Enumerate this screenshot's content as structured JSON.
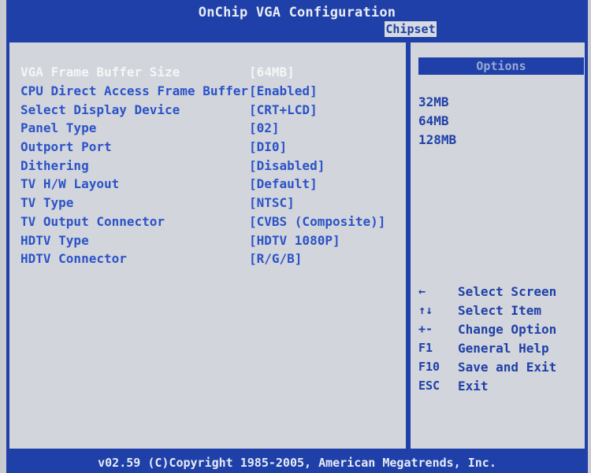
{
  "header": {
    "title": "OnChip VGA Configuration",
    "tab_label": "Chipset"
  },
  "settings": [
    {
      "label": "VGA Frame Buffer Size",
      "value": "[64MB]"
    },
    {
      "label": "CPU Direct Access Frame Buffer",
      "value": "[Enabled]"
    },
    {
      "label": "Select Display Device",
      "value": "[CRT+LCD]"
    },
    {
      "label": "Panel Type",
      "value": "[02]"
    },
    {
      "label": "Outport Port",
      "value": "[DI0]"
    },
    {
      "label": "Dithering",
      "value": "[Disabled]"
    },
    {
      "label": "TV H/W Layout",
      "value": "[Default]"
    },
    {
      "label": "TV Type",
      "value": "[NTSC]"
    },
    {
      "label": "TV Output Connector",
      "value": "[CVBS (Composite)]"
    },
    {
      "label": "HDTV Type",
      "value": "[HDTV 1080P]"
    },
    {
      "label": "HDTV Connector",
      "value": "[R/G/B]"
    }
  ],
  "options": {
    "header": "Options",
    "items": [
      "32MB",
      "64MB",
      "128MB"
    ]
  },
  "help": [
    {
      "key": "←",
      "desc": "Select Screen"
    },
    {
      "key": "↑↓",
      "desc": "Select Item"
    },
    {
      "key": "+-",
      "desc": "Change Option"
    },
    {
      "key": "F1",
      "desc": "General Help"
    },
    {
      "key": "F10",
      "desc": "Save and Exit"
    },
    {
      "key": "ESC",
      "desc": "Exit"
    }
  ],
  "footer": {
    "text": "v02.59 (C)Copyright 1985-2005, American Megatrends, Inc."
  },
  "colors": {
    "bios_blue": "#1f40a8",
    "background": "#d2d5db",
    "highlight_text": "#f5f6f8",
    "item_text": "#2b53c8"
  }
}
